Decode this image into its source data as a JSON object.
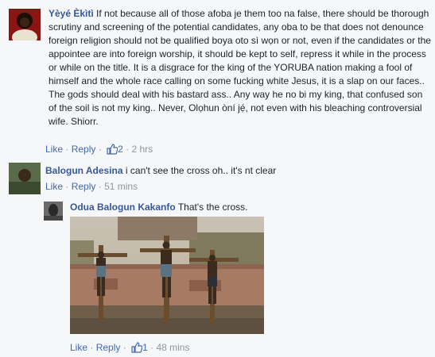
{
  "comments": [
    {
      "author": "Yèyé Èkìtì",
      "text": "If not because all of those afoba je them too na false, there should be thorough scrutiny and screening of the potential candidates, any oba to be that does not denounce foreign religion should not be qualified boya oto sì wọn or not, even if the candidates or the appointee are into foreign worship, it should be kept to self, repress it while in the process or while on the title. It is a disgrace for the king of the YORUBA nation making a fool of himself and the whole race calling on some fucking white Jesus, it is a slap on our faces.. The gods should deal with his bastard ass.. Any way he no bi my king, that confused son of the soil is not my king.. Never, Olọhun òní jẹ́, not even with his bleaching controversial wife. Shiorr.",
      "like": "Like",
      "reply": "Reply",
      "likes": "2",
      "time": "2 hrs"
    },
    {
      "author": "Balogun Adesina",
      "text": "i can't see the cross oh.. it's nt clear",
      "like": "Like",
      "reply": "Reply",
      "time": "51 mins"
    },
    {
      "author": "Odua Balogun Kakanfo",
      "text": "That's the cross.",
      "like": "Like",
      "reply": "Reply",
      "likes": "1",
      "time": "48 mins"
    }
  ],
  "separator": "·",
  "colors": {
    "link": "#4267b2",
    "name": "#365899",
    "meta": "#90949c",
    "bg": "#f6f7f9"
  }
}
